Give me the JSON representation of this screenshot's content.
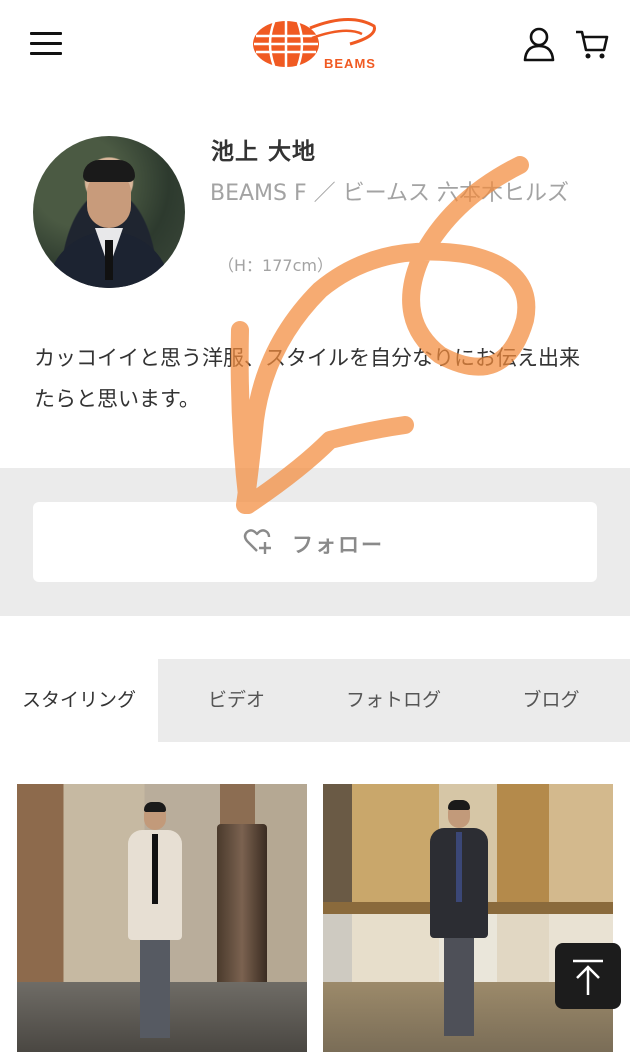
{
  "header": {
    "logo_text": "BEAMS",
    "menu_icon": "hamburger-menu-icon",
    "user_icon": "user-icon",
    "cart_icon": "cart-icon",
    "brand_color": "#f05a22"
  },
  "profile": {
    "name": "池上 大地",
    "shop": "BEAMS F ／ ビームス 六本木ヒルズ",
    "height": "（H：177cm）",
    "bio": "カッコイイと思う洋服、スタイルを自分なりにお伝え出来たらと思います。"
  },
  "follow": {
    "label": "フォロー",
    "icon": "heart-plus-icon"
  },
  "tabs": [
    {
      "label": "スタイリング",
      "active": true
    },
    {
      "label": "ビデオ",
      "active": false
    },
    {
      "label": "フォトログ",
      "active": false
    },
    {
      "label": "ブログ",
      "active": false
    }
  ],
  "gallery": [
    {
      "alt": "styling-photo"
    },
    {
      "alt": "styling-photo"
    }
  ],
  "back_to_top": {
    "icon": "arrow-up-icon"
  },
  "overlay": {
    "color": "#f28a3c",
    "description_icon": "handwritten-scribble"
  }
}
